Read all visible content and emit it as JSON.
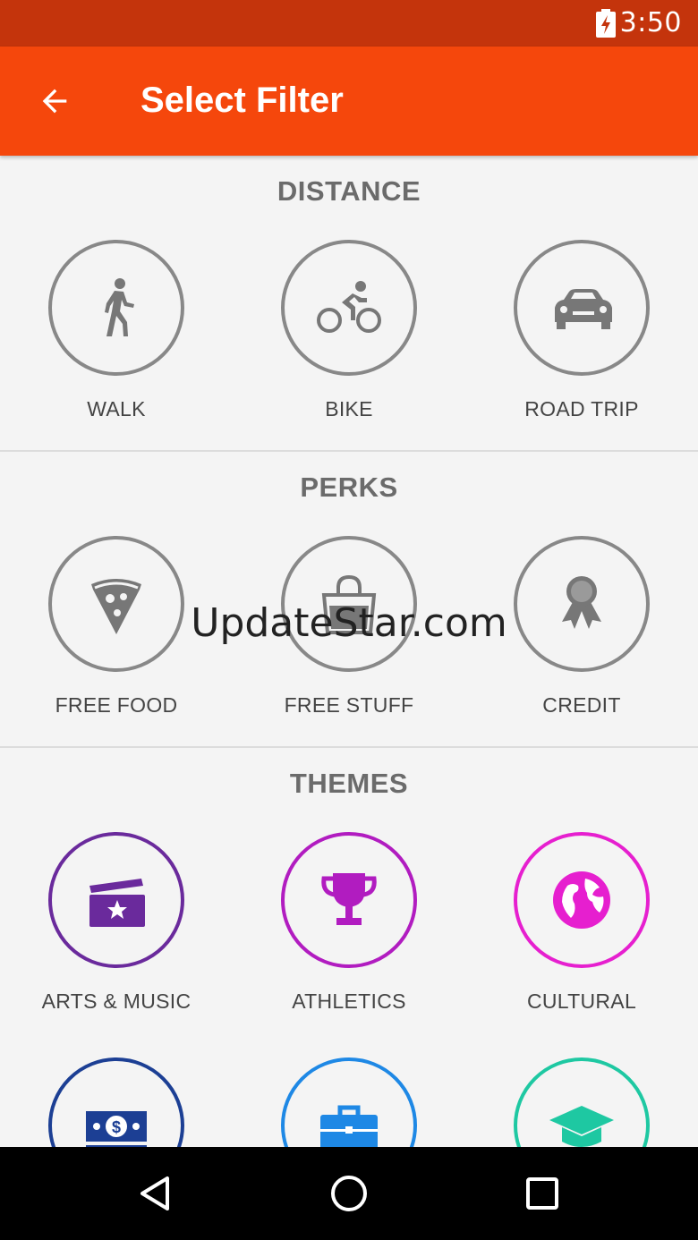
{
  "status_bar": {
    "time": "3:50",
    "battery_icon": "battery-charging-icon"
  },
  "app_bar": {
    "title": "Select Filter",
    "back_icon": "arrow-back-icon"
  },
  "sections": [
    {
      "title": "DISTANCE",
      "items": [
        {
          "label": "WALK",
          "icon": "walk-icon",
          "color": "#888888"
        },
        {
          "label": "BIKE",
          "icon": "bike-icon",
          "color": "#888888"
        },
        {
          "label": "ROAD TRIP",
          "icon": "car-icon",
          "color": "#888888"
        }
      ]
    },
    {
      "title": "PERKS",
      "items": [
        {
          "label": "FREE FOOD",
          "icon": "pizza-icon",
          "color": "#888888"
        },
        {
          "label": "FREE STUFF",
          "icon": "shopping-bag-icon",
          "color": "#888888"
        },
        {
          "label": "CREDIT",
          "icon": "award-ribbon-icon",
          "color": "#888888"
        }
      ]
    },
    {
      "title": "THEMES",
      "items": [
        {
          "label": "ARTS & MUSIC",
          "icon": "clapperboard-icon",
          "color": "#6a2a9c"
        },
        {
          "label": "ATHLETICS",
          "icon": "trophy-icon",
          "color": "#b11cc0"
        },
        {
          "label": "CULTURAL",
          "icon": "globe-icon",
          "color": "#e61fcf"
        },
        {
          "label": "",
          "icon": "money-icon",
          "color": "#1c3f94"
        },
        {
          "label": "",
          "icon": "briefcase-icon",
          "color": "#1e88e5"
        },
        {
          "label": "",
          "icon": "graduation-cap-icon",
          "color": "#1ec8a2"
        }
      ]
    }
  ],
  "watermark": "UpdateStar.com",
  "nav_bar": {
    "back_icon": "nav-back-icon",
    "home_icon": "nav-home-icon",
    "recents_icon": "nav-recents-icon"
  }
}
